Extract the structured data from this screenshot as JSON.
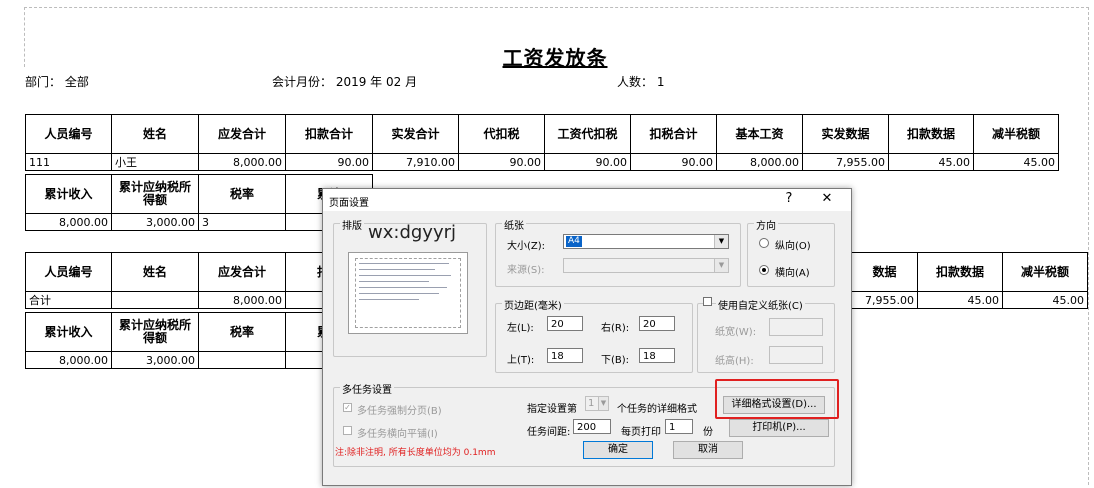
{
  "report": {
    "title": "工资发放条",
    "dept_label": "部门：  全部",
    "month_label": "会计月份：  2019 年 02 月",
    "count_label": "人数：  1",
    "headers1": [
      "人员编号",
      "姓名",
      "应发合计",
      "扣款合计",
      "实发合计",
      "代扣税",
      "工资代扣税",
      "扣税合计",
      "基本工资",
      "实发数据",
      "扣款数据",
      "减半税额"
    ],
    "row1": [
      "111",
      "小王",
      "8,000.00",
      "90.00",
      "7,910.00",
      "90.00",
      "90.00",
      "90.00",
      "8,000.00",
      "7,955.00",
      "45.00",
      "45.00"
    ],
    "headers2": [
      "累计收入",
      "累计应纳税所得额",
      "税率",
      "累计"
    ],
    "row2": [
      "8,000.00",
      "3,000.00",
      "3",
      ""
    ],
    "headers3": [
      "人员编号",
      "姓名",
      "应发合计",
      "扣款",
      "数据",
      "扣款数据",
      "减半税额"
    ],
    "row3": [
      "合计",
      "",
      "8,000.00",
      "",
      "7,955.00",
      "45.00",
      "45.00"
    ],
    "headers4": [
      "累计收入",
      "累计应纳税所得额",
      "税率",
      "累计"
    ],
    "row4": [
      "8,000.00",
      "3,000.00",
      "",
      ""
    ]
  },
  "dialog": {
    "title": "页面设置",
    "help": "?",
    "close": "✕",
    "preview_group": "排版",
    "watermark": "wx:dgyyrj",
    "paper_group": "纸张",
    "size_label": "大小(Z):",
    "size_value": "A4",
    "source_label": "来源(S):",
    "orientation_group": "方向",
    "portrait": "纵向(O)",
    "landscape": "横向(A)",
    "margin_group": "页边距(毫米)",
    "left_label": "左(L):",
    "left_value": "20",
    "right_label": "右(R):",
    "right_value": "20",
    "top_label": "上(T):",
    "top_value": "18",
    "bottom_label": "下(B):",
    "bottom_value": "18",
    "custom_paper_label": "使用自定义纸张(C)",
    "paper_width_label": "纸宽(W):",
    "paper_height_label": "纸高(H):",
    "multitask_group": "多任务设置",
    "force_page_label": "多任务强制分页(B)",
    "horizontal_label": "多任务横向平铺(I)",
    "note": "注:除非注明, 所有长度单位均为 0.1mm",
    "specify_label": "指定设置第",
    "specify_value": "1",
    "specify_suffix": "个任务的详细格式",
    "detail_button": "详细格式设置(D)...",
    "spacing_label": "任务间距:",
    "spacing_value": "200",
    "per_page_label": "每页打印",
    "per_page_value": "1",
    "per_page_unit": "份",
    "printer_button": "打印机(P)...",
    "ok_button": "确定",
    "cancel_button": "取消"
  },
  "colors": {
    "highlight": "#e02020",
    "selection": "#0a64c8"
  }
}
